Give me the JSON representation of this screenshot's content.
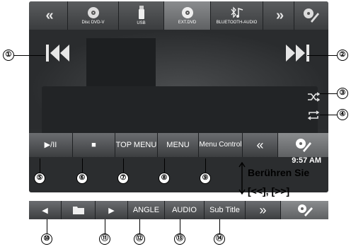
{
  "top_tabs": [
    {
      "label": "«",
      "icon": "double-left-arrow-icon"
    },
    {
      "label": "Disc DVD-V",
      "icon": "disc-icon"
    },
    {
      "label": "USB",
      "icon": "usb-stick-icon"
    },
    {
      "label": "EXT.DVD",
      "icon": "disc-icon",
      "active": true
    },
    {
      "label": "BLUETOOTH-AUDIO",
      "icon": "bluetooth-music-icon"
    },
    {
      "label": "»",
      "icon": "double-right-arrow-icon"
    },
    {
      "label": "",
      "icon": "settings-wrench-icon"
    }
  ],
  "control_bar": [
    {
      "label": "▶/II"
    },
    {
      "label": "■"
    },
    {
      "label": "TOP MENU"
    },
    {
      "label": "MENU"
    },
    {
      "label": "Menu Control"
    },
    {
      "label": "«"
    },
    {
      "label": ""
    }
  ],
  "status": {
    "time": "9:57 AM"
  },
  "note": {
    "line1": "Berühren Sie",
    "line2": "[<<], [>>]"
  },
  "control_bar2": [
    {
      "label": "◀"
    },
    {
      "label": ""
    },
    {
      "label": "▶"
    },
    {
      "label": "ANGLE"
    },
    {
      "label": "AUDIO"
    },
    {
      "label": "Sub Title"
    },
    {
      "label": "»"
    },
    {
      "label": ""
    }
  ],
  "callouts": [
    "①",
    "②",
    "③",
    "④",
    "⑤",
    "⑥",
    "⑦",
    "⑧",
    "⑨",
    "⑩",
    "⑪",
    "⑫",
    "⑬",
    "⑭"
  ]
}
